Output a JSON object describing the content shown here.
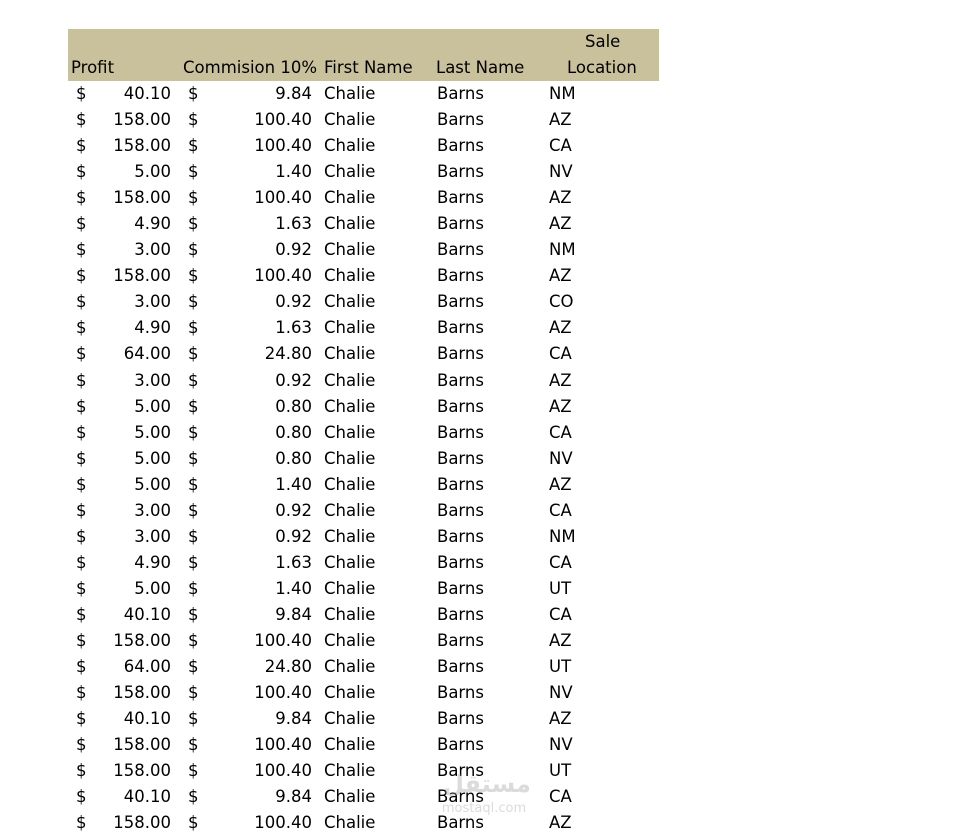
{
  "header": {
    "profit": "Profit",
    "commission": "Commision 10%",
    "first_name": "First Name",
    "last_name": "Last Name",
    "sale_line1": "Sale",
    "sale_line2": "Location"
  },
  "currency_symbol": "$",
  "rows": [
    {
      "profit": "40.10",
      "commission": "9.84",
      "first": "Chalie",
      "last": "Barns",
      "loc": "NM"
    },
    {
      "profit": "158.00",
      "commission": "100.40",
      "first": "Chalie",
      "last": "Barns",
      "loc": "AZ"
    },
    {
      "profit": "158.00",
      "commission": "100.40",
      "first": "Chalie",
      "last": "Barns",
      "loc": "CA"
    },
    {
      "profit": "5.00",
      "commission": "1.40",
      "first": "Chalie",
      "last": "Barns",
      "loc": "NV"
    },
    {
      "profit": "158.00",
      "commission": "100.40",
      "first": "Chalie",
      "last": "Barns",
      "loc": "AZ"
    },
    {
      "profit": "4.90",
      "commission": "1.63",
      "first": "Chalie",
      "last": "Barns",
      "loc": "AZ"
    },
    {
      "profit": "3.00",
      "commission": "0.92",
      "first": "Chalie",
      "last": "Barns",
      "loc": "NM"
    },
    {
      "profit": "158.00",
      "commission": "100.40",
      "first": "Chalie",
      "last": "Barns",
      "loc": "AZ"
    },
    {
      "profit": "3.00",
      "commission": "0.92",
      "first": "Chalie",
      "last": "Barns",
      "loc": "CO"
    },
    {
      "profit": "4.90",
      "commission": "1.63",
      "first": "Chalie",
      "last": "Barns",
      "loc": "AZ"
    },
    {
      "profit": "64.00",
      "commission": "24.80",
      "first": "Chalie",
      "last": "Barns",
      "loc": "CA"
    },
    {
      "profit": "3.00",
      "commission": "0.92",
      "first": "Chalie",
      "last": "Barns",
      "loc": "AZ"
    },
    {
      "profit": "5.00",
      "commission": "0.80",
      "first": "Chalie",
      "last": "Barns",
      "loc": "AZ"
    },
    {
      "profit": "5.00",
      "commission": "0.80",
      "first": "Chalie",
      "last": "Barns",
      "loc": "CA"
    },
    {
      "profit": "5.00",
      "commission": "0.80",
      "first": "Chalie",
      "last": "Barns",
      "loc": "NV"
    },
    {
      "profit": "5.00",
      "commission": "1.40",
      "first": "Chalie",
      "last": "Barns",
      "loc": "AZ"
    },
    {
      "profit": "3.00",
      "commission": "0.92",
      "first": "Chalie",
      "last": "Barns",
      "loc": "CA"
    },
    {
      "profit": "3.00",
      "commission": "0.92",
      "first": "Chalie",
      "last": "Barns",
      "loc": "NM"
    },
    {
      "profit": "4.90",
      "commission": "1.63",
      "first": "Chalie",
      "last": "Barns",
      "loc": "CA"
    },
    {
      "profit": "5.00",
      "commission": "1.40",
      "first": "Chalie",
      "last": "Barns",
      "loc": "UT"
    },
    {
      "profit": "40.10",
      "commission": "9.84",
      "first": "Chalie",
      "last": "Barns",
      "loc": "CA"
    },
    {
      "profit": "158.00",
      "commission": "100.40",
      "first": "Chalie",
      "last": "Barns",
      "loc": "AZ"
    },
    {
      "profit": "64.00",
      "commission": "24.80",
      "first": "Chalie",
      "last": "Barns",
      "loc": "UT"
    },
    {
      "profit": "158.00",
      "commission": "100.40",
      "first": "Chalie",
      "last": "Barns",
      "loc": "NV"
    },
    {
      "profit": "40.10",
      "commission": "9.84",
      "first": "Chalie",
      "last": "Barns",
      "loc": "AZ"
    },
    {
      "profit": "158.00",
      "commission": "100.40",
      "first": "Chalie",
      "last": "Barns",
      "loc": "NV"
    },
    {
      "profit": "158.00",
      "commission": "100.40",
      "first": "Chalie",
      "last": "Barns",
      "loc": "UT"
    },
    {
      "profit": "40.10",
      "commission": "9.84",
      "first": "Chalie",
      "last": "Barns",
      "loc": "CA"
    },
    {
      "profit": "158.00",
      "commission": "100.40",
      "first": "Chalie",
      "last": "Barns",
      "loc": "AZ"
    }
  ],
  "watermark": {
    "brand": "مستقل",
    "domain": "mostaql.com"
  },
  "colors": {
    "header_bg": "#c9c09c",
    "text": "#000000",
    "watermark": "#9a9a9a"
  }
}
